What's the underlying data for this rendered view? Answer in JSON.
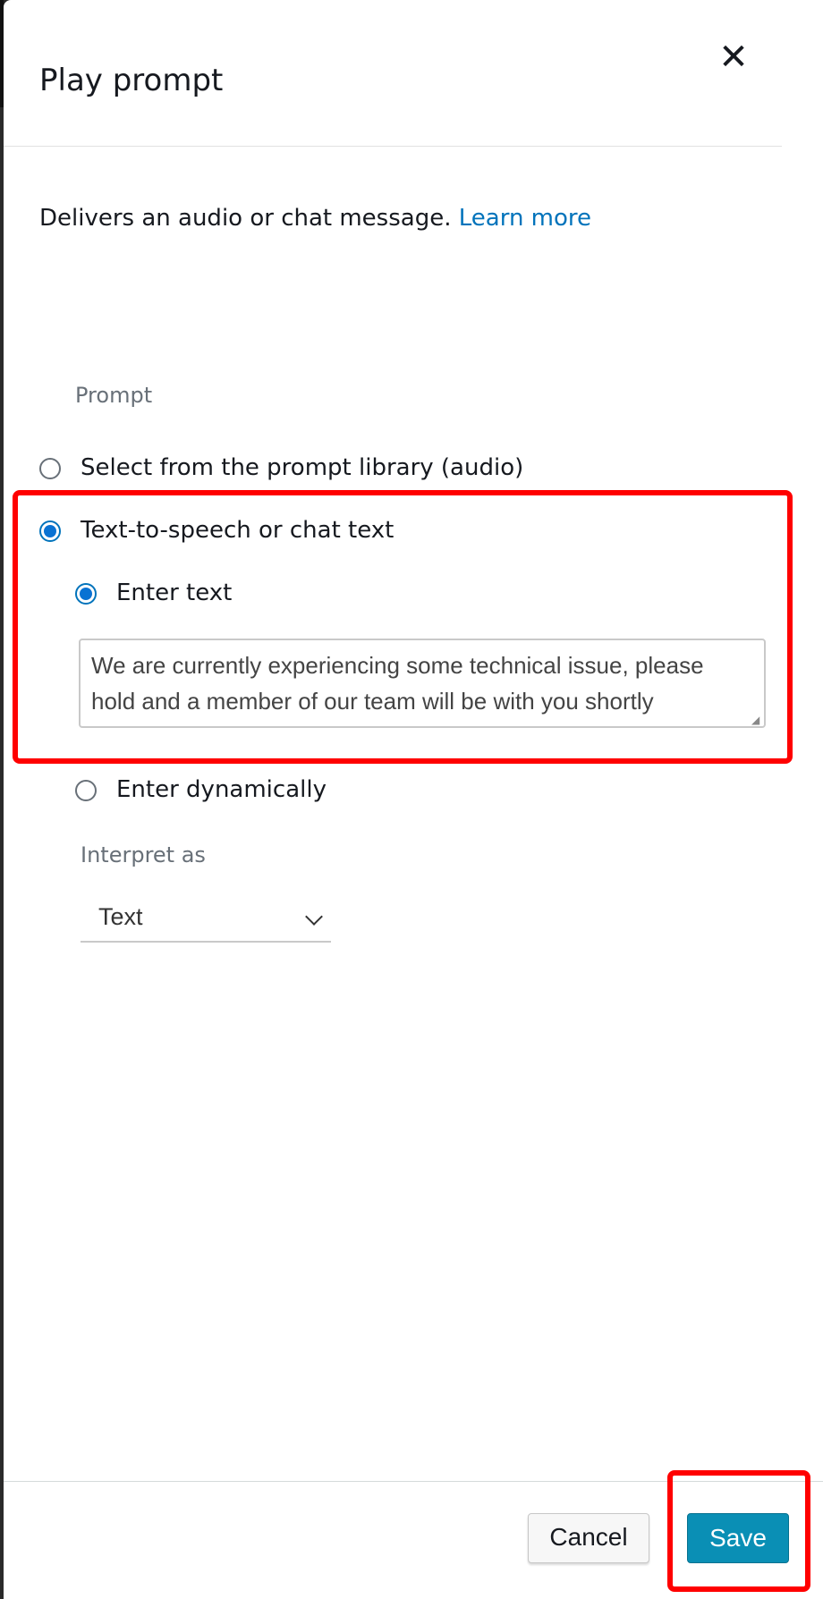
{
  "dialog": {
    "title": "Play prompt",
    "close_icon": "close-icon"
  },
  "description": {
    "text": "Delivers an audio or chat message.",
    "link": "Learn more"
  },
  "prompt": {
    "label": "Prompt",
    "options": [
      {
        "label": "Select from the prompt library (audio)",
        "selected": false
      },
      {
        "label": "Text-to-speech or chat text",
        "selected": true
      }
    ],
    "sub_options": [
      {
        "label": "Enter text",
        "selected": true
      },
      {
        "label": "Enter dynamically",
        "selected": false
      }
    ],
    "text_value": "We are currently experiencing some technical issue, please hold and a member of our team will be with you shortly"
  },
  "interpret": {
    "label": "Interpret as",
    "value": "Text"
  },
  "footer": {
    "cancel_label": "Cancel",
    "save_label": "Save"
  },
  "colors": {
    "accent": "#0972d3",
    "link": "#0073bb",
    "save_button": "#0a8fb5",
    "highlight": "#ff0000"
  }
}
